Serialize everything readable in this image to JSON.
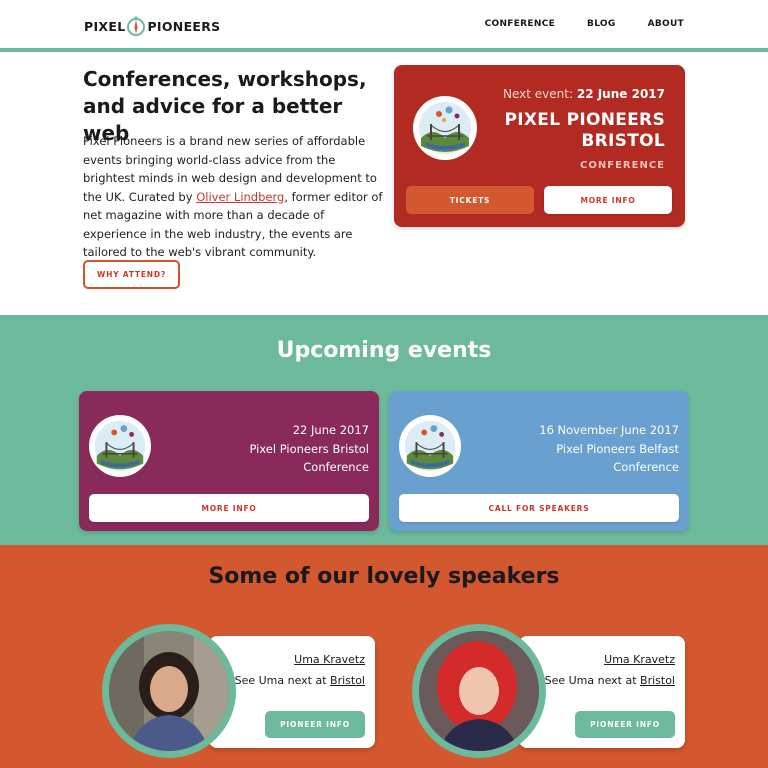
{
  "header": {
    "logo_left": "PIXEL",
    "logo_right": "PIONEERS",
    "nav": [
      "CONFERENCE",
      "BLOG",
      "ABOUT"
    ]
  },
  "hero": {
    "title": "Conferences, workshops, and advice for a better web",
    "text_before_link": "Pixel Pioneers is a brand new series of affordable events bringing world-class advice from the brightest minds in web design and development to the UK. Curated by ",
    "link_text": "Oliver Lindberg",
    "text_after_link": ", former editor of net magazine with more than a decade of experience in the web industry, the events are tailored to the web's vibrant community.",
    "button": "WHY ATTEND?"
  },
  "next_event": {
    "label": "Next event: ",
    "date": "22 June 2017",
    "title": "PIXEL PIONEERS BRISTOL",
    "type": "CONFERENCE",
    "tickets_button": "TICKETS",
    "info_button": "MORE INFO"
  },
  "upcoming": {
    "title": "Upcoming events",
    "events": [
      {
        "date": "22 June 2017",
        "name": "Pixel Pioneers Bristol",
        "type": "Conference",
        "button": "MORE INFO",
        "color": "#8a2a5a"
      },
      {
        "date": "16 November June 2017",
        "name": "Pixel Pioneers Belfast",
        "type": "Conference",
        "button": "CALL FOR SPEAKERS",
        "color": "#6aa0d0"
      }
    ]
  },
  "speakers": {
    "title": "Some of our lovely speakers",
    "items": [
      {
        "name": "Uma Kravetz",
        "next_prefix": "See Uma next at ",
        "next_link": "Bristol",
        "button": "PIONEER INFO"
      },
      {
        "name": "Uma Kravetz",
        "next_prefix": "See Uma next at ",
        "next_link": "Bristol",
        "button": "PIONEER INFO"
      }
    ]
  },
  "colors": {
    "green": "#6cb99b",
    "red": "#b22a22",
    "orange": "#d3572f",
    "plum": "#8a2a5a",
    "blue": "#6aa0d0"
  }
}
